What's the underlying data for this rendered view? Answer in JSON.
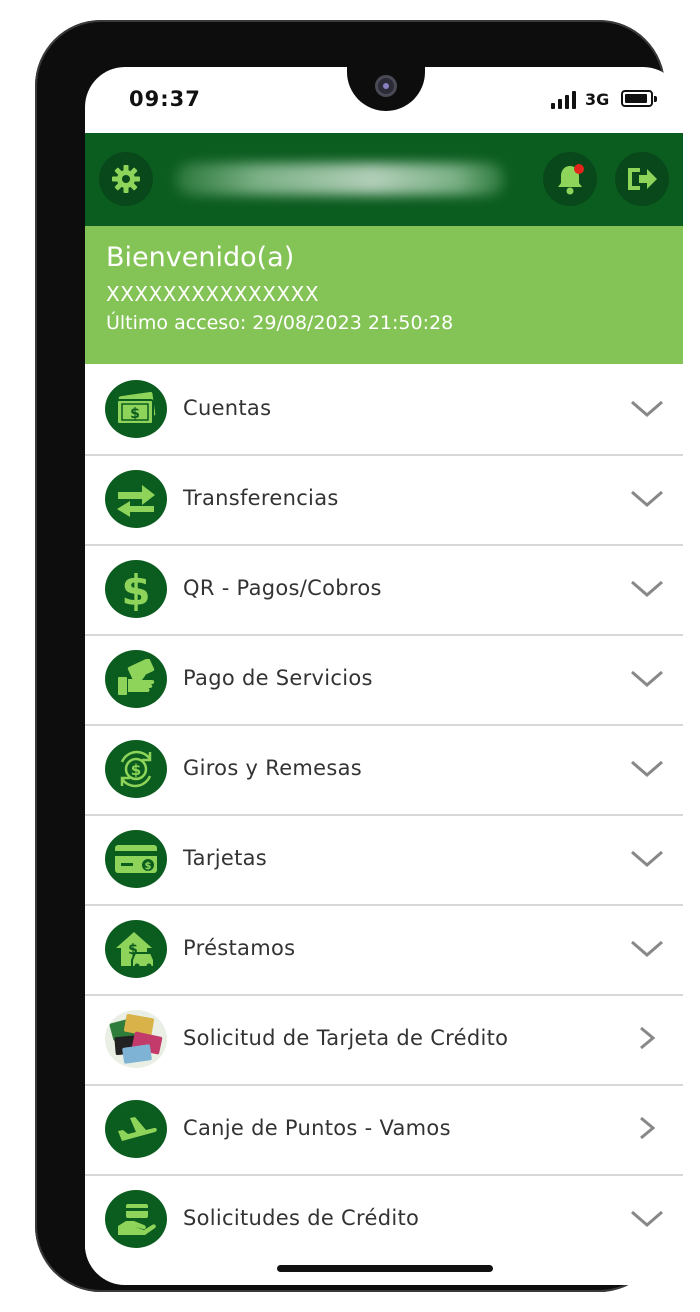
{
  "status_bar": {
    "time": "09:37",
    "network": "3G"
  },
  "header": {
    "user_name_blurred": true
  },
  "welcome": {
    "greeting": "Bienvenido(a)",
    "user": "XXXXXXXXXXXXXXX",
    "last_access": "Último acceso: 29/08/2023 21:50:28"
  },
  "menu": {
    "items": [
      {
        "label": "Cuentas",
        "icon": "cash-icon",
        "chevron": "down"
      },
      {
        "label": "Transferencias",
        "icon": "transfer-arrows-icon",
        "chevron": "down"
      },
      {
        "label": "QR - Pagos/Cobros",
        "icon": "dollar-icon",
        "chevron": "down"
      },
      {
        "label": "Pago de Servicios",
        "icon": "hand-money-icon",
        "chevron": "down"
      },
      {
        "label": "Giros y Remesas",
        "icon": "money-cycle-icon",
        "chevron": "down"
      },
      {
        "label": "Tarjetas",
        "icon": "credit-card-icon",
        "chevron": "down"
      },
      {
        "label": "Préstamos",
        "icon": "house-car-loan-icon",
        "chevron": "down"
      },
      {
        "label": "Solicitud de Tarjeta de Crédito",
        "icon": "cards-photo-icon",
        "chevron": "right"
      },
      {
        "label": "Canje de Puntos - Vamos",
        "icon": "airplane-icon",
        "chevron": "right"
      },
      {
        "label": "Solicitudes de Crédito",
        "icon": "hand-card-icon",
        "chevron": "down"
      }
    ]
  },
  "colors": {
    "dark_green": "#0b5c1f",
    "light_green": "#84c456",
    "icon_green": "#8fd45a",
    "notification_dot": "#e0261b"
  }
}
